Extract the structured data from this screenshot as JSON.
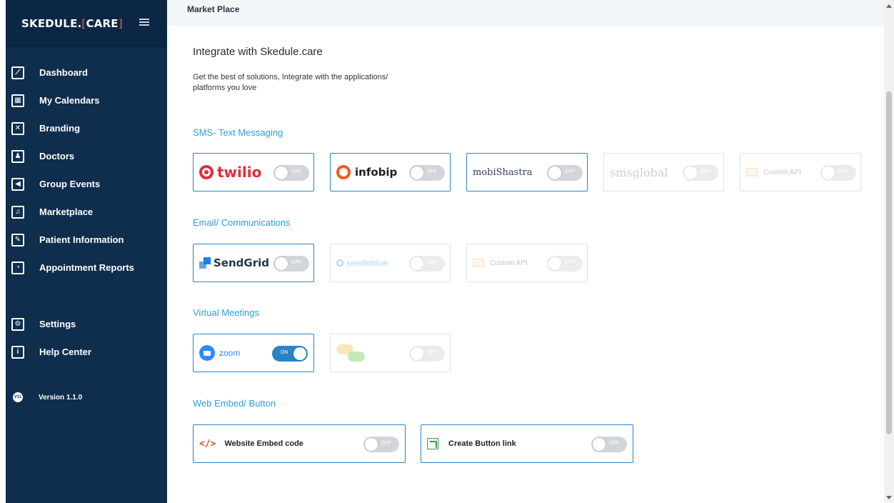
{
  "app": {
    "brand_primary": "SKEDULE.",
    "brand_bracket_open": "[",
    "brand_secondary": "CARE",
    "brand_bracket_close": "]"
  },
  "colors": {
    "sidebar_bg": "#0f2d4c",
    "accent": "#2a9fd6",
    "tile_border": "#2a83c5",
    "brand_bracket": "#f26b2d"
  },
  "sidebar": {
    "items": [
      {
        "label": "Dashboard",
        "icon": "chart-icon"
      },
      {
        "label": "My Calendars",
        "icon": "calendar-icon"
      },
      {
        "label": "Branding",
        "icon": "branding-icon"
      },
      {
        "label": "Doctors",
        "icon": "user-icon"
      },
      {
        "label": "Group Events",
        "icon": "megaphone-icon"
      },
      {
        "label": "Marketplace",
        "icon": "marketplace-icon"
      },
      {
        "label": "Patient Information",
        "icon": "document-icon"
      },
      {
        "label": "Appointment Reports",
        "icon": "pie-chart-icon"
      }
    ],
    "bottom_items": [
      {
        "label": "Settings",
        "icon": "gear-icon"
      },
      {
        "label": "Help Center",
        "icon": "info-icon"
      }
    ],
    "version_badge": "V11",
    "version_label": "Version 1.1.0"
  },
  "header": {
    "title": "Market Place"
  },
  "main": {
    "heading": "Integrate with Skedule.care",
    "subheading": "Get the best of solutions, Integrate with the applications/ platforms you love",
    "sections": {
      "sms": {
        "title": "SMS- Text Messaging",
        "tiles": [
          {
            "name": "twilio",
            "toggle": "OFF"
          },
          {
            "name": "infobip",
            "toggle": "OFF"
          },
          {
            "name": "mobiShastra",
            "toggle": "OFF"
          },
          {
            "name": "smsglobal",
            "toggle": "OFF"
          },
          {
            "name": "Custom API",
            "toggle": "OFF"
          }
        ]
      },
      "email": {
        "title": "Email/ Communications",
        "tiles": [
          {
            "name": "SendGrid",
            "toggle": "OFF"
          },
          {
            "name": "sendinblue",
            "toggle": "OFF"
          },
          {
            "name": "Custom API",
            "toggle": "OFF"
          }
        ]
      },
      "meetings": {
        "title": "Virtual Meetings",
        "tiles": [
          {
            "name": "zoom",
            "toggle": "ON"
          },
          {
            "name": "",
            "toggle": "OFF"
          }
        ]
      },
      "embed": {
        "title": "Web Embed/ Button",
        "tiles": [
          {
            "name": "Website Embed code",
            "icon_glyph": "</>",
            "toggle": "OFF"
          },
          {
            "name": "Create Button link",
            "toggle": "OFF"
          }
        ]
      }
    }
  }
}
